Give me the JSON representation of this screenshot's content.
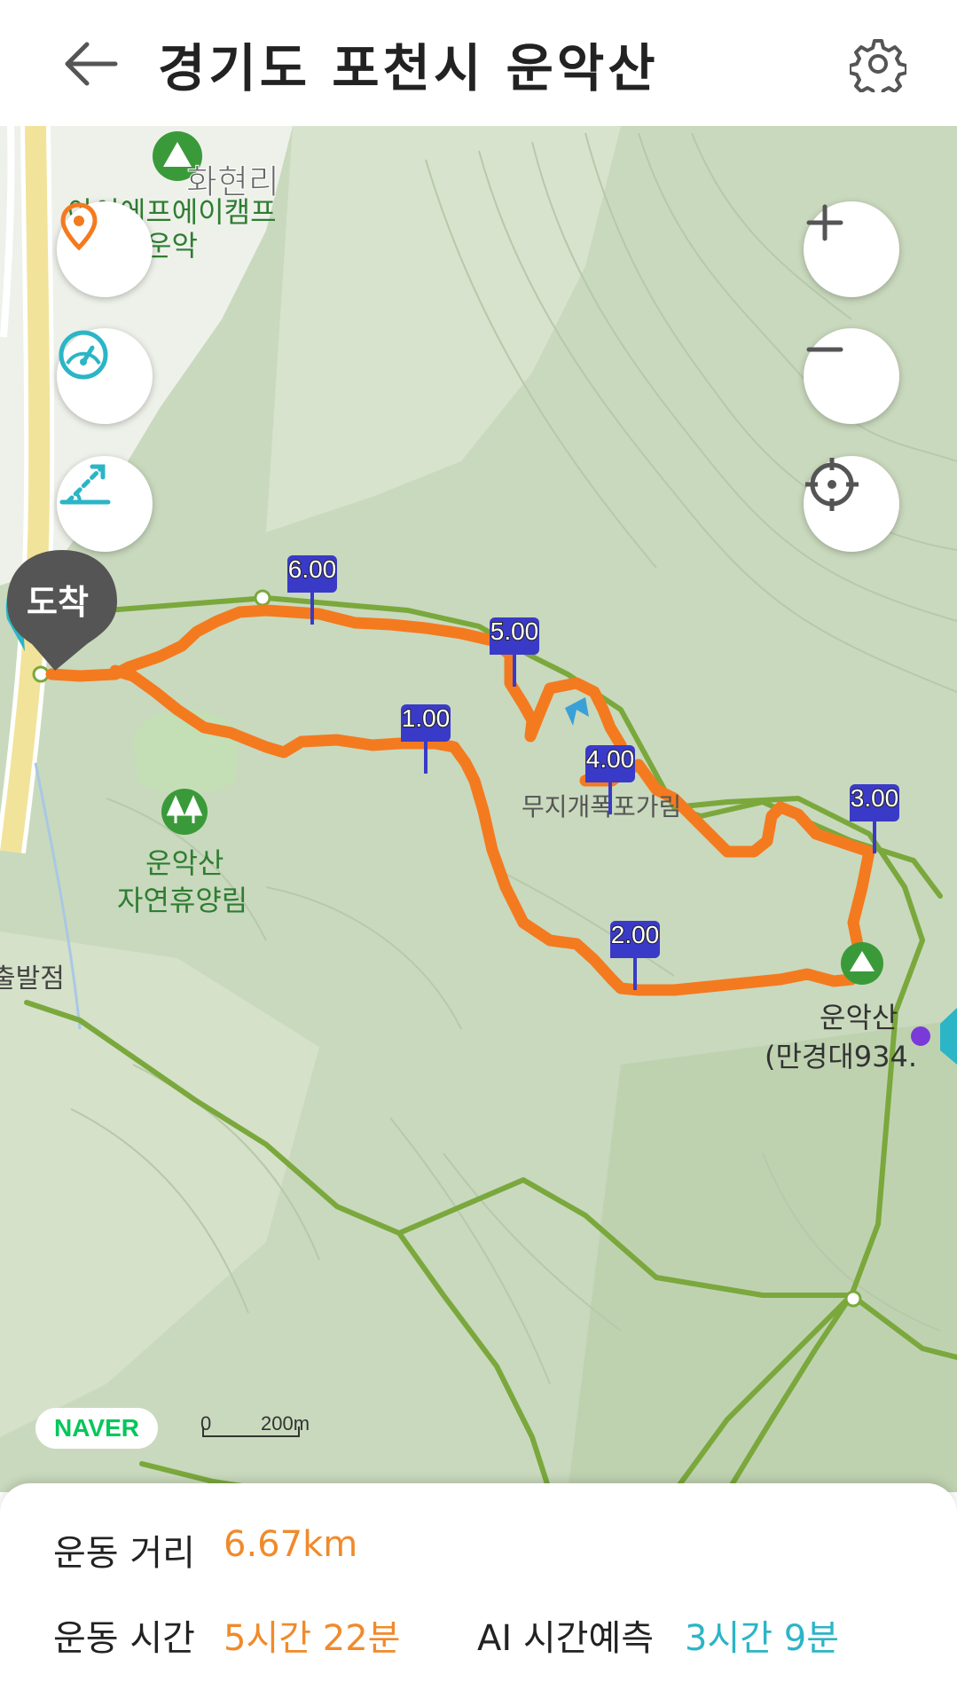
{
  "header": {
    "title": "경기도 포천시 운악산"
  },
  "map": {
    "places": {
      "village": "화현리",
      "camp_line1": "아이에프에이캠프",
      "camp_line2": "운악",
      "forest_line1": "운악산",
      "forest_line2": "자연휴양림",
      "temple": "무지개폭포가림",
      "start_point": "출발점",
      "peak_line1": "운악산",
      "peak_line2": "(만경대934."
    },
    "arrival_pin": "도착",
    "km_markers": [
      "1.00",
      "2.00",
      "3.00",
      "4.00",
      "5.00",
      "6.00"
    ],
    "naver_logo": "NAVER",
    "scale": {
      "zero": "0",
      "length": "200m"
    },
    "colors": {
      "track": "#f47a20",
      "trail": "#7aa83c",
      "marker": "#3a3ac8",
      "pin": "#555555"
    }
  },
  "stats": {
    "distance_label": "운동 거리",
    "distance_value": "6.67km",
    "time_label": "운동 시간",
    "time_value": "5시간 22분",
    "ai_label": "AI 시간예측",
    "ai_value": "3시간 9분"
  }
}
